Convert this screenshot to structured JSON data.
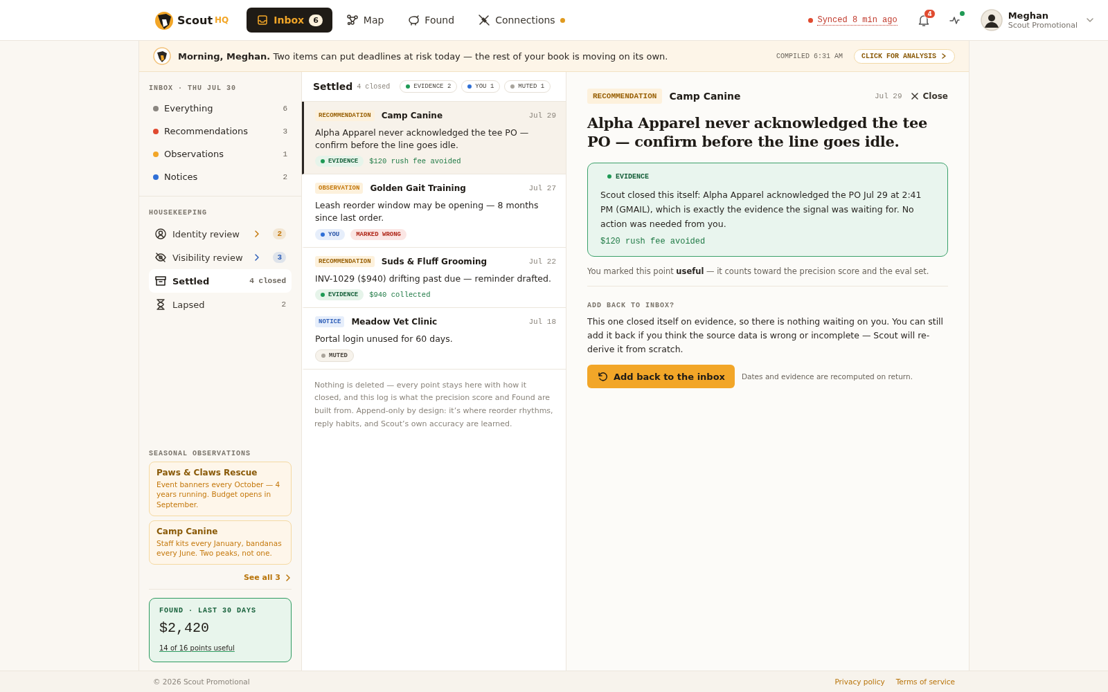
{
  "brand": {
    "name": "Scout",
    "suffix": "HQ"
  },
  "nav": [
    {
      "label": "Inbox",
      "selected": true,
      "badge": "6",
      "dot": false
    },
    {
      "label": "Map",
      "selected": false,
      "dot": false
    },
    {
      "label": "Found",
      "selected": false,
      "dot": false
    },
    {
      "label": "Connections",
      "selected": false,
      "dot": true
    }
  ],
  "sync": {
    "text": "Synced 8 min ago"
  },
  "notifications": {
    "count": "4"
  },
  "user": {
    "name": "Meghan",
    "org": "Scout Promotional"
  },
  "banner": {
    "text": "**Morning, Meghan.** Two items can put deadlines at risk today — the rest of your book is moving on its own.",
    "compiled": "COMPILED 6:31 AM",
    "action": "CLICK FOR ANALYSIS"
  },
  "sidebar": {
    "heading": "INBOX · THU JUL 30",
    "filters": [
      {
        "label": "Everything",
        "count": "6",
        "color": "#8a8680"
      },
      {
        "label": "Recommendations",
        "count": "3",
        "color": "#e04a2f"
      },
      {
        "label": "Observations",
        "count": "1",
        "color": "#f2a628"
      },
      {
        "label": "Notices",
        "count": "2",
        "color": "#2f6fd6"
      }
    ],
    "housekeeping_heading": "HOUSEKEEPING",
    "housekeeping": [
      {
        "label": "Identity review",
        "count": "2",
        "kind": "review",
        "color": "#c4780c",
        "selected": false
      },
      {
        "label": "Visibility review",
        "count": "3",
        "kind": "review",
        "color": "#2f5fb8",
        "selected": false
      },
      {
        "label": "Settled",
        "count": "4 closed",
        "kind": "plain",
        "selected": true
      },
      {
        "label": "Lapsed",
        "count": "2",
        "kind": "plain",
        "selected": false
      }
    ],
    "seasonal_heading": "SEASONAL OBSERVATIONS",
    "seasonal": [
      {
        "title": "Paws & Claws Rescue",
        "text": "Event banners every October — 4 years running. Budget opens in September."
      },
      {
        "title": "Camp Canine",
        "text": "Staff kits every January, bandanas every June. Two peaks, not one."
      }
    ],
    "see_all": {
      "label": "See all",
      "count": "3"
    },
    "found": {
      "label": "FOUND · LAST 30 DAYS",
      "amount": "$2,420",
      "link": "14 of 16 points useful"
    }
  },
  "list": {
    "title": "Settled",
    "subtitle": "4 closed",
    "chips": [
      {
        "label": "EVIDENCE",
        "count": "2",
        "color": "#1f9a55"
      },
      {
        "label": "YOU",
        "count": "1",
        "color": "#2f6fd6"
      },
      {
        "label": "MUTED",
        "count": "1",
        "color": "#a8a49c"
      }
    ],
    "items": [
      {
        "kind": "recommendation",
        "type_label": "RECOMMENDATION",
        "org": "Camp Canine",
        "date": "Jul 29",
        "text": "Alpha Apparel never acknowledged the tee PO — confirm before the line goes idle.",
        "selected": true,
        "tags": [
          {
            "kind": "evidence",
            "label": "EVIDENCE"
          }
        ],
        "outcome": "$120 rush fee avoided"
      },
      {
        "kind": "observation",
        "type_label": "OBSERVATION",
        "org": "Golden Gait Training",
        "date": "Jul 27",
        "text": "Leash reorder window may be opening — 8 months since last order.",
        "selected": false,
        "tags": [
          {
            "kind": "you",
            "label": "YOU"
          },
          {
            "kind": "wrong",
            "label": "MARKED WRONG"
          }
        ]
      },
      {
        "kind": "recommendation",
        "type_label": "RECOMMENDATION",
        "org": "Suds & Fluff Grooming",
        "date": "Jul 22",
        "text": "INV-1029 ($940) drifting past due — reminder drafted.",
        "selected": false,
        "tags": [
          {
            "kind": "evidence",
            "label": "EVIDENCE"
          }
        ],
        "outcome": "$940 collected"
      },
      {
        "kind": "notice",
        "type_label": "NOTICE",
        "org": "Meadow Vet Clinic",
        "date": "Jul 18",
        "text": "Portal login unused for 60 days.",
        "selected": false,
        "tags": [
          {
            "kind": "muted",
            "label": "MUTED"
          }
        ]
      }
    ],
    "note": "Nothing is deleted — every point stays here with how it closed, and this log is what the precision score and Found are built from. Append-only by design: it’s where reorder rhythms, reply habits, and Scout’s own accuracy are learned."
  },
  "detail": {
    "kind": "recommendation",
    "type_label": "RECOMMENDATION",
    "org": "Camp Canine",
    "date": "Jul 29",
    "close": "Close",
    "title": "Alpha Apparel never acknowledged the tee PO — confirm before the line goes idle.",
    "evidence": {
      "label": "EVIDENCE",
      "text": "Scout closed this itself: Alpha Apparel acknowledged the PO Jul 29 at 2:41 PM (GMAIL), which is exactly the evidence the signal was waiting for. No action was needed from you.",
      "outcome": "$120 rush fee avoided"
    },
    "marked": "You marked this point **useful** — it counts toward the precision score and the eval set.",
    "section_heading": "ADD BACK TO INBOX?",
    "section_text": "This one closed itself on evidence, so there is nothing waiting on you. You can still add it back if you think the source data is wrong or incomplete — Scout will re-derive it from scratch.",
    "button": "Add back to the inbox",
    "hint": "Dates and evidence are recomputed on return."
  },
  "footer": {
    "copyright": "© 2026 Scout Promotional",
    "links": [
      "Privacy policy",
      "Terms of service"
    ]
  }
}
